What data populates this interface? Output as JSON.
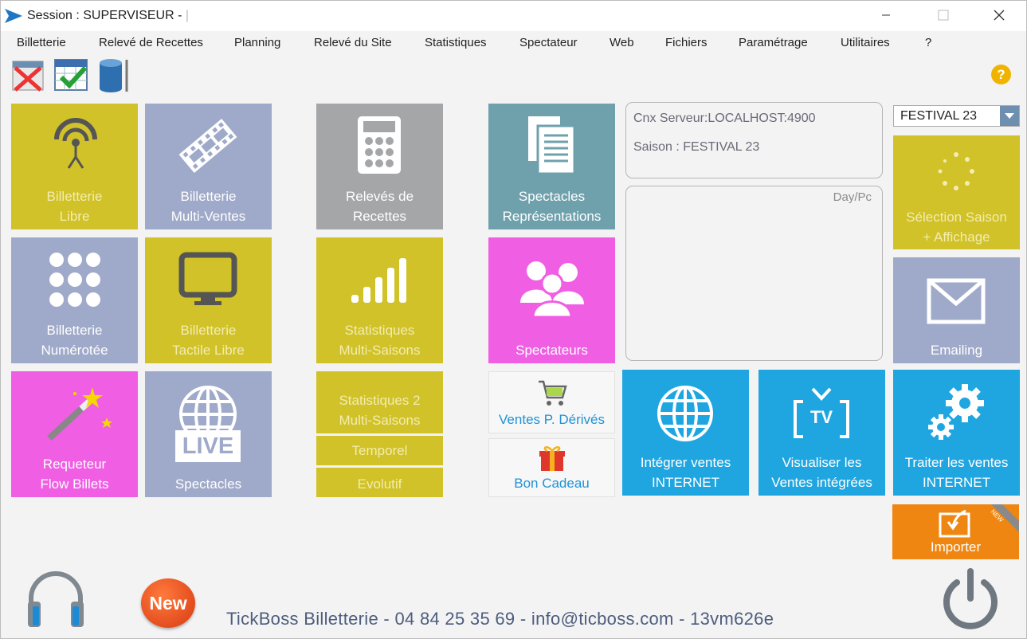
{
  "window": {
    "title": "Session : SUPERVISEUR - ",
    "title_separator": "|"
  },
  "menu": [
    "Billetterie",
    "Relevé de Recettes",
    "Planning",
    "Relevé du Site",
    "Statistiques",
    "Spectateur",
    "Web",
    "Fichiers",
    "Paramétrage",
    "Utilitaires",
    "?"
  ],
  "toolbar": {
    "icons": [
      "cancel-ticket-icon",
      "calendar-check-icon",
      "database-icon"
    ],
    "help_label": "?"
  },
  "tiles": {
    "billetterie_libre": [
      "Billetterie",
      "Libre"
    ],
    "billetterie_multi_ventes": [
      "Billetterie",
      "Multi-Ventes"
    ],
    "releves_de_recettes": [
      "Relevés de",
      "Recettes"
    ],
    "spectacles_representations": [
      "Spectacles",
      "Représentations"
    ],
    "billetterie_numerotee": [
      "Billetterie",
      "Numérotée"
    ],
    "billetterie_tactile_libre": [
      "Billetterie",
      "Tactile Libre"
    ],
    "statistiques_multi_saisons": [
      "Statistiques",
      "Multi-Saisons"
    ],
    "spectateurs": "Spectateurs",
    "requeteur_flow_billets": [
      "Requeteur",
      "Flow Billets"
    ],
    "spectacles_live": "Spectacles",
    "live_badge": "LIVE",
    "statistiques_2": [
      "Statistiques 2",
      "Multi-Saisons"
    ],
    "temporel": "Temporel",
    "evolutif": "Evolutif",
    "ventes_p_derives": "Ventes P. Dérivés",
    "bon_cadeau": "Bon Cadeau",
    "integrer_ventes": [
      "Intégrer ventes",
      "INTERNET"
    ],
    "visualiser_ventes": [
      "Visualiser les",
      "Ventes intégrées"
    ],
    "traiter_ventes": [
      "Traiter les ventes",
      "INTERNET"
    ],
    "selection_saison": [
      "Sélection Saison",
      "+ Affichage"
    ],
    "emailing": "Emailing",
    "importer": "Importer",
    "tv_badge": "TV",
    "new_ribbon": "NEW"
  },
  "server_info": {
    "connection": "Cnx Serveur:LOCALHOST:4900",
    "season": "Saison : FESTIVAL 23"
  },
  "log_panel": {
    "header": "Day/Pc"
  },
  "season_select": {
    "value": "FESTIVAL 23"
  },
  "footer": {
    "contact": "TickBoss Billetterie - 04 84 25 35 69 - info@ticboss.com - 13vm626e",
    "new_badge": "New"
  },
  "colors": {
    "yellow": "#d0c228",
    "steel_blue": "#9fa9c9",
    "gray": "#a5a6a8",
    "teal": "#6fa1ad",
    "pink": "#ef5ee3",
    "blue": "#1fa6e0",
    "orange": "#ef8612"
  }
}
